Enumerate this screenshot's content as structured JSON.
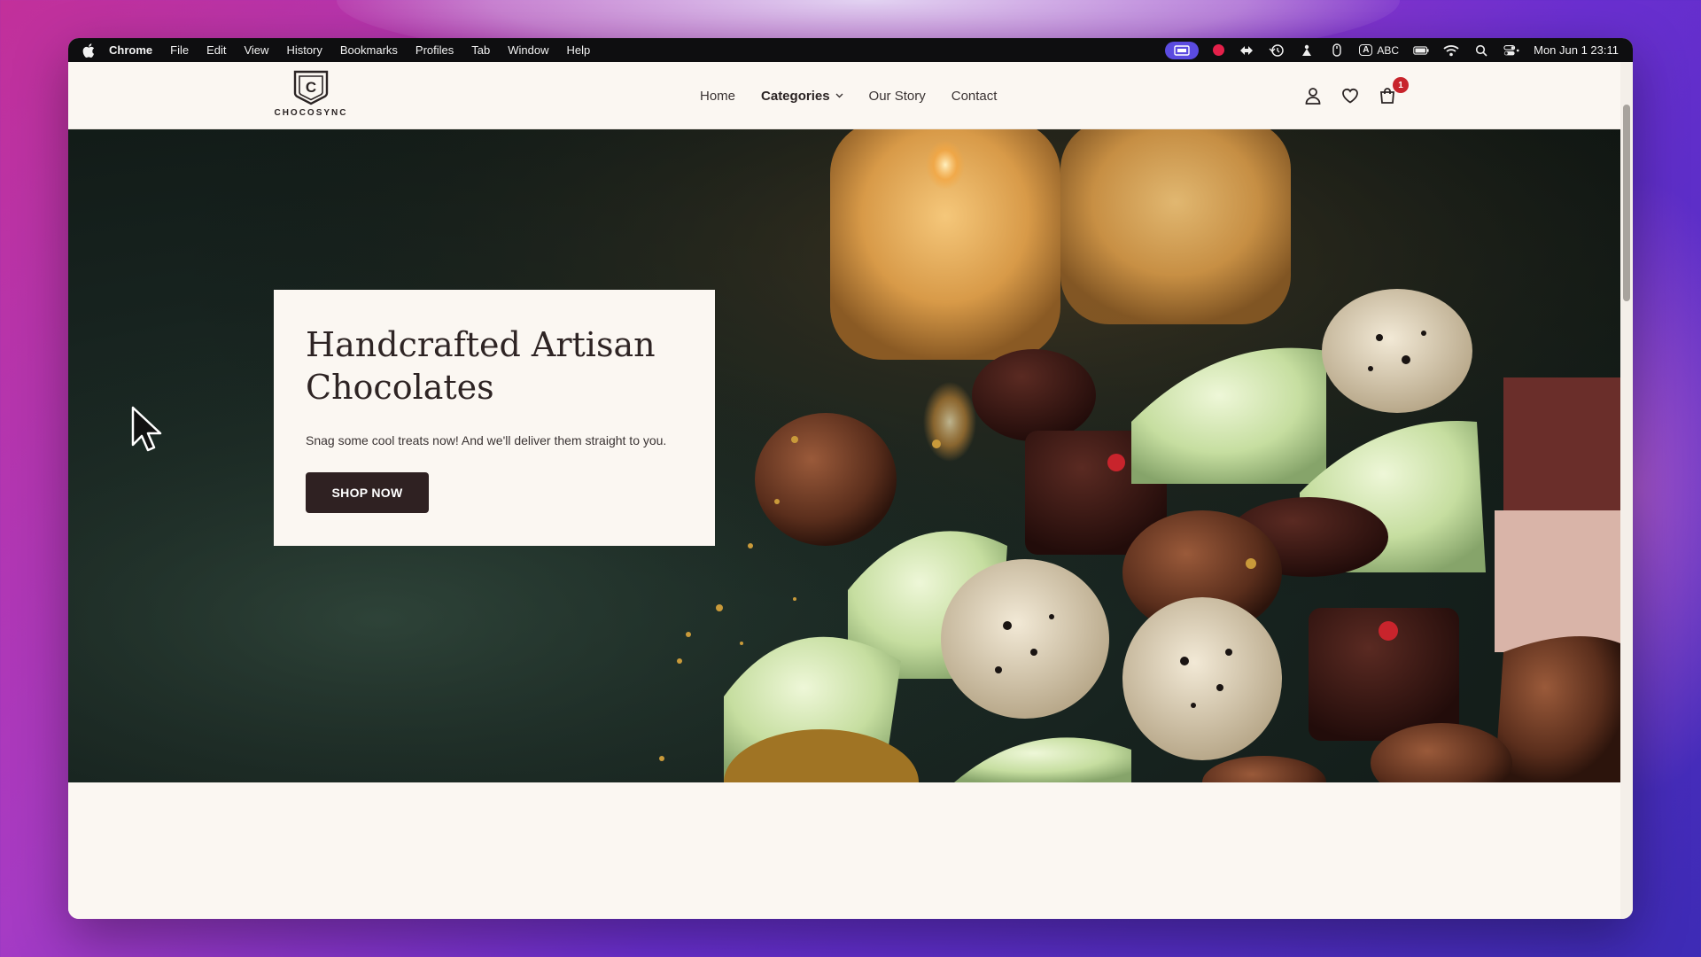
{
  "os_menubar": {
    "app_name": "Chrome",
    "menus": [
      "File",
      "Edit",
      "View",
      "History",
      "Bookmarks",
      "Profiles",
      "Tab",
      "Window",
      "Help"
    ],
    "input_source": "ABC",
    "input_badge": "A",
    "clock": "Mon Jun 1  23:11"
  },
  "site": {
    "brand": "CHOCOSYNC",
    "logo_letter": "C",
    "nav": {
      "home": "Home",
      "categories": "Categories",
      "our_story": "Our Story",
      "contact": "Contact"
    },
    "cart_count": "1"
  },
  "hero": {
    "title_line1": "Handcrafted Artisan",
    "title_line2": "Chocolates",
    "subtitle": "Snag some cool treats now! And we'll deliver them straight to you.",
    "cta": "SHOP NOW"
  },
  "colors": {
    "brand_dark": "#2f2122",
    "badge_red": "#c8242c",
    "page_bg": "#fbf7f2",
    "hero_bg": "#17231f"
  }
}
